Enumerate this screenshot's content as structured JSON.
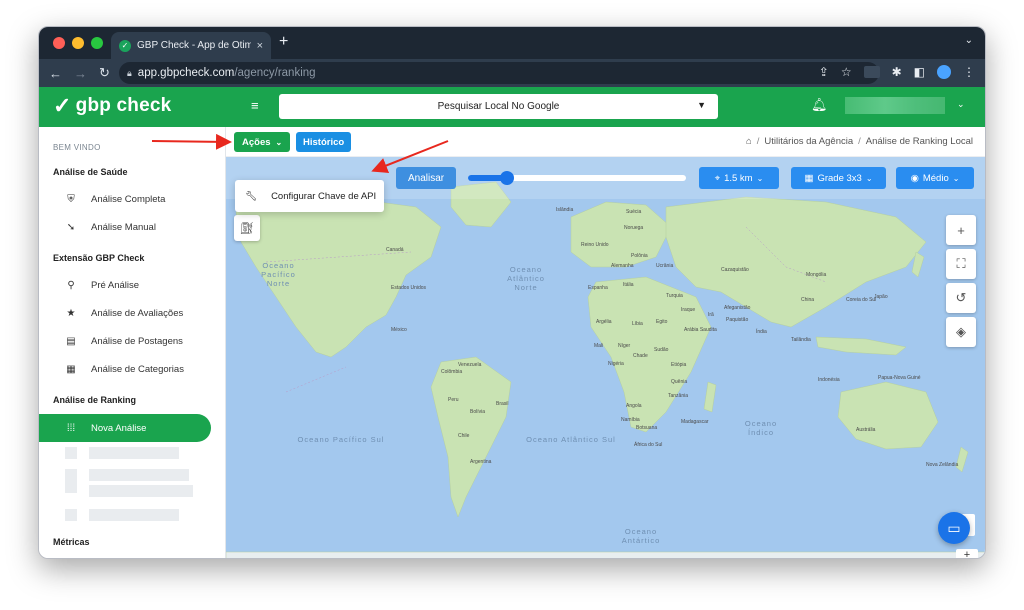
{
  "browser": {
    "tab_title": "GBP Check - App de Otimizaç",
    "tab_close": "×",
    "new_tab": "+",
    "url_host": "app.gbpcheck.com",
    "url_path": "/agency/ranking"
  },
  "header": {
    "logo": "gbp check",
    "search_select_value": "Pesquisar Local No Google"
  },
  "sidebar": {
    "welcome": "BEM VINDO",
    "sections": [
      {
        "title": "Análise de Saúde",
        "items": [
          "Análise Completa",
          "Análise Manual"
        ]
      },
      {
        "title": "Extensão GBP Check",
        "items": [
          "Pré Análise",
          "Análise de Avaliações",
          "Análise de Postagens",
          "Análise de Categorias"
        ]
      },
      {
        "title": "Análise de Ranking",
        "items": [
          "Nova Análise"
        ]
      },
      {
        "title": "Métricas",
        "items": []
      }
    ]
  },
  "toolbar": {
    "acoes_label": "Ações",
    "historico_label": "Histórico",
    "breadcrumb": [
      "Utilitários da Agência",
      "Análise de Ranking Local"
    ],
    "breadcrumb_sep": "/"
  },
  "dropdown": {
    "item_label": "Configurar Chave de API"
  },
  "map_controls": {
    "analisar_label": "Analisar",
    "slider_value": 0.18,
    "radius_label": "1.5 km",
    "grid_label": "Grade 3x3",
    "zoom_label": "Médio"
  },
  "map_labels": {
    "oceans": [
      "Oceano Pacífico Norte",
      "Oceano Atlântico Norte",
      "Oceano Pacífico Sul",
      "Oceano Atlântico Sul",
      "Oceano Índico",
      "Oceano Antártico"
    ],
    "places": [
      "Islândia",
      "Suécia",
      "Noruega",
      "Reino Unido",
      "Polônia",
      "Alemanha",
      "Ucrânia",
      "Espanha",
      "Itália",
      "Cazaquistão",
      "Mongólia",
      "Turquia",
      "China",
      "Coreia do Sul",
      "Japão",
      "Afeganistão",
      "Iraque",
      "Irã",
      "Paquistão",
      "Índia",
      "Tailândia",
      "Canadá",
      "Estados Unidos",
      "México",
      "Argélia",
      "Líbia",
      "Egito",
      "Arábia Saudita",
      "Mali",
      "Níger",
      "Chade",
      "Sudão",
      "Nigéria",
      "Etiópia",
      "Quênia",
      "Tanzânia",
      "Angola",
      "Namíbia",
      "Botsuana",
      "Madagascar",
      "África do Sul",
      "Indonésia",
      "Papua-Nova Guiné",
      "Austrália",
      "Nova Zelândia",
      "Venezuela",
      "Colômbia",
      "Peru",
      "Bolívia",
      "Brasil",
      "Chile",
      "Argentina"
    ]
  },
  "colors": {
    "brand_green": "#1aa44e",
    "primary_blue": "#2a8df0",
    "annotation_red": "#e8281e"
  }
}
